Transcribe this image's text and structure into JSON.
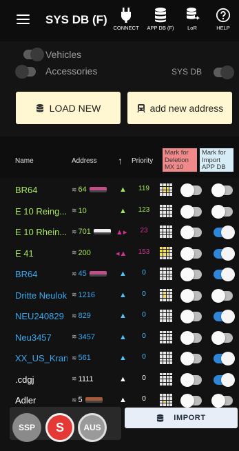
{
  "appbar": {
    "title": "SYS DB (F)",
    "actions": [
      {
        "icon": "plug-icon",
        "label": "CONNECT"
      },
      {
        "icon": "database-icon",
        "label": "APP DB (F)"
      },
      {
        "icon": "database-export-icon",
        "label": "LoR"
      },
      {
        "icon": "help-circle-icon",
        "label": "HELP"
      }
    ]
  },
  "filters": {
    "vehicles_label": "Vehicles",
    "accessories_label": "Accessories",
    "sysdb_label": "SYS DB"
  },
  "buttons": {
    "load_new": "LOAD NEW",
    "add_address": "add new address",
    "import": "IMPORT"
  },
  "table_header": {
    "name": "Name",
    "address": "Address",
    "sort_arrow": "↑",
    "priority": "Priority",
    "mark_delete": "Mark for Deletion MX 10",
    "mark_import": "Mark for Import APP DB"
  },
  "rows": [
    {
      "name": "BR64",
      "address": "64",
      "prio": "119",
      "color": "#a5e45a",
      "dir": "▲",
      "dircolor": "#a5e45a",
      "prio_color": "#a5e45a",
      "loco": "#c0508a",
      "grid": [
        0,
        0,
        0,
        0,
        0,
        1,
        1,
        0,
        0,
        1,
        1,
        0,
        0,
        0,
        0,
        0
      ],
      "sw2": "off"
    },
    {
      "name": "E 10 Reing...",
      "address": "10",
      "prio": "123",
      "color": "#a5e45a",
      "dir": "▲",
      "dircolor": "#a5e45a",
      "prio_color": "#a5e45a",
      "loco": "",
      "grid": [
        0,
        0,
        0,
        0,
        0,
        0,
        0,
        0,
        0,
        0,
        0,
        0,
        0,
        0,
        0,
        0
      ],
      "sw2": "off"
    },
    {
      "name": "E 10 Rhein...",
      "address": "701",
      "prio": "23",
      "color": "#a5e45a",
      "dir": "▲▸",
      "dircolor": "#d4308f",
      "prio_color": "#d4308f",
      "loco": "#eeeeee",
      "grid": [
        0,
        0,
        0,
        0,
        0,
        0,
        0,
        0,
        0,
        0,
        0,
        0,
        0,
        0,
        0,
        0
      ],
      "sw2": "on"
    },
    {
      "name": "E 41",
      "address": "200",
      "prio": "153",
      "color": "#a5e45a",
      "dir": "◂▲",
      "dircolor": "#d4308f",
      "prio_color": "#d4308f",
      "loco": "",
      "grid": [
        1,
        1,
        1,
        0,
        1,
        1,
        1,
        0,
        1,
        1,
        1,
        0,
        0,
        0,
        0,
        0
      ],
      "sw2": "on"
    },
    {
      "name": "BR64",
      "address": "45",
      "prio": "0",
      "color": "#3aa8f0",
      "dir": "▲",
      "dircolor": "#4fc3f7",
      "prio_color": "#4fc3f7",
      "loco": "#c0508a",
      "grid": [
        0,
        0,
        0,
        0,
        0,
        0,
        0,
        0,
        0,
        0,
        0,
        0,
        0,
        0,
        0,
        0
      ],
      "sw2": "on"
    },
    {
      "name": "Dritte Neulok",
      "address": "1216",
      "prio": "0",
      "color": "#3aa8f0",
      "dir": "▲",
      "dircolor": "#4fc3f7",
      "prio_color": "#4fc3f7",
      "loco": "",
      "grid": [
        0,
        0,
        0,
        0,
        0,
        1,
        0,
        0,
        0,
        1,
        0,
        0,
        0,
        0,
        0,
        0
      ],
      "sw2": "off"
    },
    {
      "name": "NEU240829",
      "address": "829",
      "prio": "0",
      "color": "#3aa8f0",
      "dir": "▲",
      "dircolor": "#4fc3f7",
      "prio_color": "#4fc3f7",
      "loco": "",
      "grid": [
        0,
        0,
        0,
        0,
        0,
        0,
        0,
        0,
        0,
        0,
        0,
        0,
        0,
        0,
        0,
        0
      ],
      "sw2": "on"
    },
    {
      "name": "Neu3457",
      "address": "3457",
      "prio": "0",
      "color": "#3aa8f0",
      "dir": "▲",
      "dircolor": "#4fc3f7",
      "prio_color": "#4fc3f7",
      "loco": "",
      "grid": [
        0,
        0,
        0,
        0,
        0,
        0,
        0,
        0,
        0,
        0,
        0,
        0,
        0,
        0,
        0,
        0
      ],
      "sw2": "off"
    },
    {
      "name": "XX_US_Kran",
      "address": "561",
      "prio": "0",
      "color": "#3aa8f0",
      "dir": "▲",
      "dircolor": "#4fc3f7",
      "prio_color": "#4fc3f7",
      "loco": "",
      "grid": [
        0,
        0,
        0,
        0,
        0,
        0,
        0,
        0,
        0,
        0,
        0,
        0,
        0,
        0,
        0,
        0
      ],
      "sw2": "on"
    },
    {
      "name": ".cdgj",
      "address": "1111",
      "prio": "0",
      "color": "#ffffff",
      "dir": "▲",
      "dircolor": "#ffffff",
      "prio_color": "#ffffff",
      "loco": "",
      "grid": [
        0,
        0,
        0,
        0,
        0,
        0,
        0,
        0,
        0,
        0,
        0,
        0,
        0,
        0,
        0,
        0
      ],
      "sw2": "on"
    },
    {
      "name": "Adler",
      "address": "5",
      "prio": "0",
      "color": "#ffffff",
      "dir": "▲",
      "dircolor": "#ffffff",
      "prio_color": "#ffffff",
      "loco": "#a55a3a",
      "grid": [
        0,
        0,
        0,
        0,
        0,
        0,
        0,
        0,
        0,
        1,
        0,
        0,
        0,
        0,
        0,
        0
      ],
      "sw2": "off"
    }
  ],
  "fabs": [
    {
      "label": "SSP",
      "color": "#8a8a8a"
    },
    {
      "label": "S",
      "color": "#e53935"
    },
    {
      "label": "AUS",
      "color": "#9a9a9a"
    }
  ],
  "colors": {
    "accent_blue": "#2f86d6",
    "cream": "#fff7d1",
    "mark_delete_bg": "#f08a8a",
    "mark_import_bg": "#d6ecf6"
  }
}
